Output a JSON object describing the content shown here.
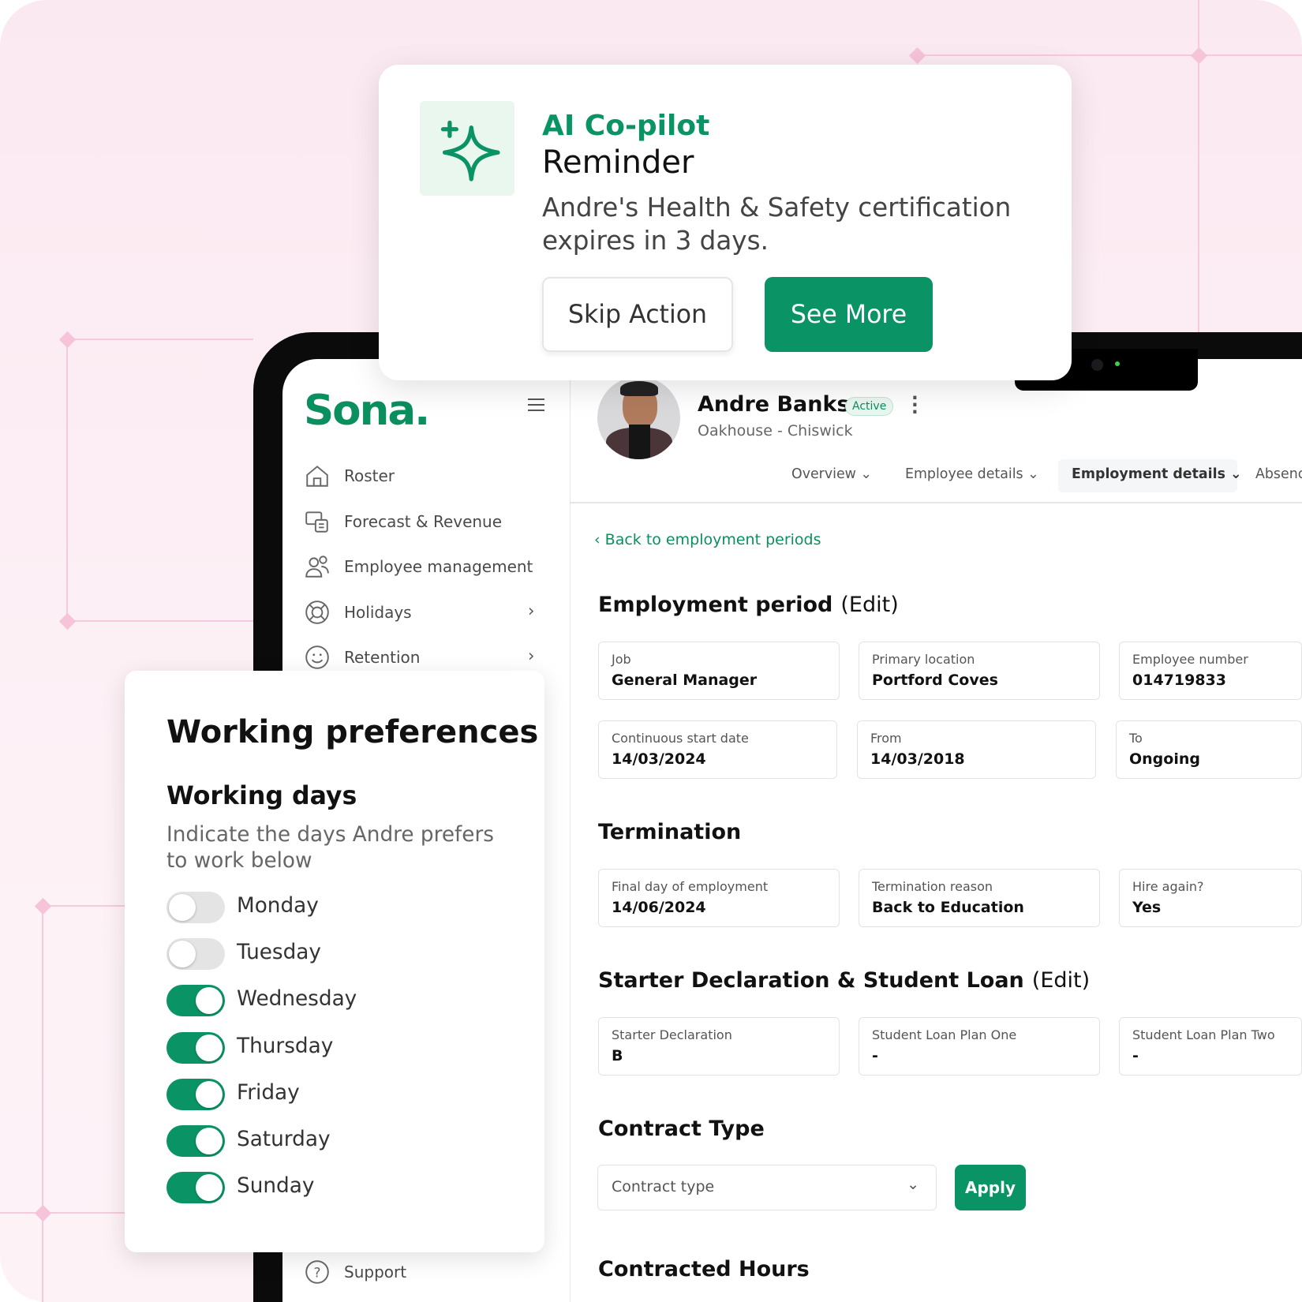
{
  "ai_card": {
    "icon": "sparkle-icon",
    "title": "AI Co-pilot",
    "subtitle": "Reminder",
    "message": "Andre's Health & Safety certification expires in 3 days.",
    "skip_label": "Skip Action",
    "see_more_label": "See More"
  },
  "sidebar": {
    "logo": "Sona.",
    "items": [
      {
        "label": "Roster",
        "icon": "home-icon"
      },
      {
        "label": "Forecast & Revenue",
        "icon": "forecast-icon"
      },
      {
        "label": "Employee management",
        "icon": "people-icon"
      },
      {
        "label": "Holidays",
        "icon": "lifebuoy-icon"
      },
      {
        "label": "Retention",
        "icon": "smile-icon"
      }
    ],
    "support": "Support"
  },
  "profile": {
    "name": "Andre Banks",
    "status": "Active",
    "location": "Oakhouse - Chiswick"
  },
  "tabs": [
    "Overview",
    "Employee details",
    "Employment details",
    "Absence"
  ],
  "active_tab": "Employment details",
  "back_link": "Back to employment periods",
  "employment_period": {
    "title": "Employment period",
    "edit": "(Edit)",
    "fields": [
      {
        "label": "Job",
        "value": "General Manager"
      },
      {
        "label": "Primary location",
        "value": "Portford Coves"
      },
      {
        "label": "Employee number",
        "value": "014719833"
      },
      {
        "label": "Continuous start date",
        "value": "14/03/2024"
      },
      {
        "label": "From",
        "value": "14/03/2018"
      },
      {
        "label": "To",
        "value": "Ongoing"
      }
    ]
  },
  "termination": {
    "title": "Termination",
    "fields": [
      {
        "label": "Final day of employment",
        "value": "14/06/2024"
      },
      {
        "label": "Termination reason",
        "value": "Back to Education"
      },
      {
        "label": "Hire again?",
        "value": "Yes"
      }
    ]
  },
  "starter": {
    "title": "Starter Declaration & Student Loan",
    "edit": "(Edit)",
    "fields": [
      {
        "label": "Starter Declaration",
        "value": "B"
      },
      {
        "label": "Student Loan Plan One",
        "value": "-"
      },
      {
        "label": "Student Loan Plan Two",
        "value": "-"
      }
    ]
  },
  "contract": {
    "title": "Contract Type",
    "placeholder": "Contract type",
    "apply": "Apply"
  },
  "contracted_hours_title": "Contracted Hours",
  "working_preferences": {
    "title": "Working preferences",
    "subtitle": "Working days",
    "description": "Indicate the days Andre prefers to work below",
    "days": [
      {
        "label": "Monday",
        "on": false
      },
      {
        "label": "Tuesday",
        "on": false
      },
      {
        "label": "Wednesday",
        "on": true
      },
      {
        "label": "Thursday",
        "on": true
      },
      {
        "label": "Friday",
        "on": true
      },
      {
        "label": "Saturday",
        "on": true
      },
      {
        "label": "Sunday",
        "on": true
      }
    ]
  },
  "colors": {
    "brand": "#0a9466",
    "background": "#fbe9f1"
  }
}
